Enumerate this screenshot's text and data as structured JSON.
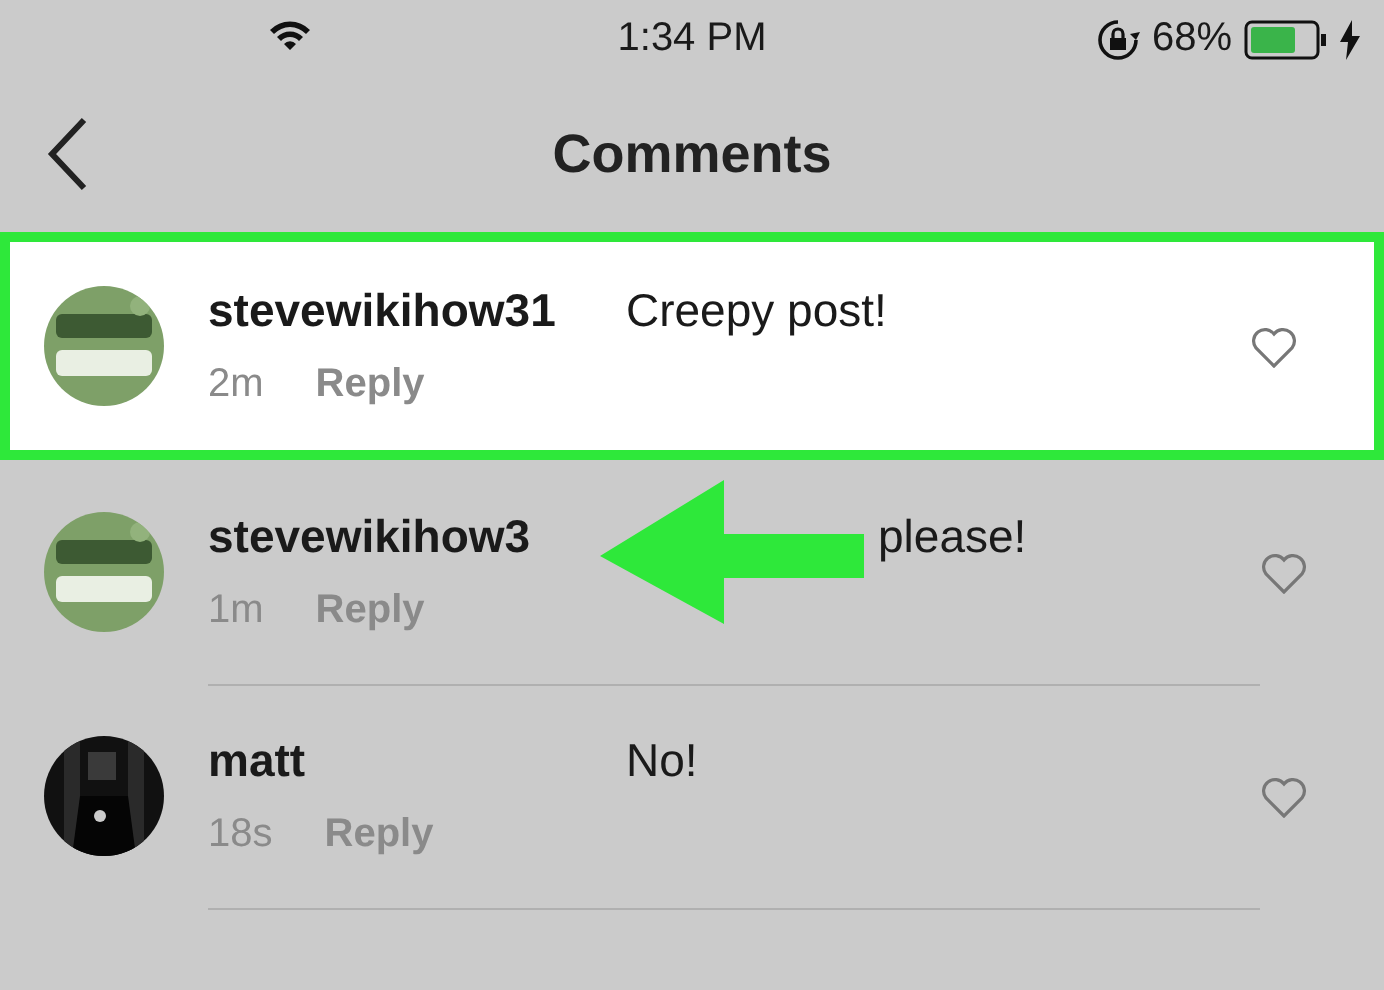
{
  "status_bar": {
    "time": "1:34 PM",
    "battery": "68%"
  },
  "header": {
    "title": "Comments"
  },
  "comments": [
    {
      "username": "stevewikihow31",
      "text": "Creepy post!",
      "age": "2m",
      "reply": "Reply",
      "selected": true,
      "arrow": false,
      "avatar": {
        "kind": "logo"
      }
    },
    {
      "username": "stevewikihow3",
      "text": "please!",
      "age": "1m",
      "reply": "Reply",
      "selected": false,
      "arrow": true,
      "avatar": {
        "kind": "logo"
      }
    },
    {
      "username": "matt",
      "text": "No!",
      "age": "18s",
      "reply": "Reply",
      "selected": false,
      "arrow": false,
      "avatar": {
        "kind": "dark"
      }
    }
  ]
}
